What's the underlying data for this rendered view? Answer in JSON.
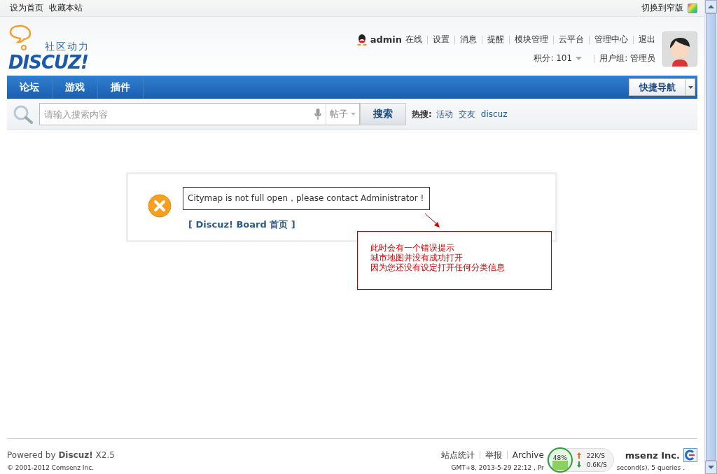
{
  "top_bar": {
    "links": [
      "设为首页",
      "收藏本站"
    ],
    "switch_label": "切换到窄版"
  },
  "logo": {
    "tagline": "社区动力",
    "wordmark": "DISCUZ!"
  },
  "user": {
    "name": "admin",
    "status": "在线",
    "links": [
      "设置",
      "消息",
      "提醒",
      "模块管理",
      "云平台",
      "管理中心",
      "退出"
    ],
    "credits": "积分: 101",
    "group": "用户组: 管理员"
  },
  "nav": {
    "items": [
      {
        "label": "论坛"
      },
      {
        "label": "游戏"
      },
      {
        "label": "插件"
      }
    ],
    "quick_nav": "快捷导航"
  },
  "search": {
    "placeholder": "请输入搜索内容",
    "type": "帖子",
    "button": "搜索",
    "hot_label": "热搜:",
    "hot": [
      "活动",
      "交友",
      "discuz"
    ]
  },
  "message": {
    "text": "Citymap is not full open，please contact Administrator !",
    "link": "[ Discuz! Board 首页 ]"
  },
  "callout": {
    "lines": [
      "此时会有一个错误提示",
      "城市地图并没有成功打开",
      "因为您还没有设定打开任何分类信息"
    ]
  },
  "footer": {
    "powered": "Powered by **Discuz!** X2.5",
    "copyright": "© 2001-2012 Comsenz Inc.",
    "links": [
      "站点统计",
      "举报",
      "Archive"
    ],
    "company": "msenz Inc.",
    "info_left": "GMT+8, 2013-5-29 22:12 , Pr",
    "info_right": "second(s), 5 queries ."
  },
  "net_meter": {
    "level": 0.48,
    "percent": "48%",
    "up": "22K/S",
    "down": "0.6K/S"
  }
}
